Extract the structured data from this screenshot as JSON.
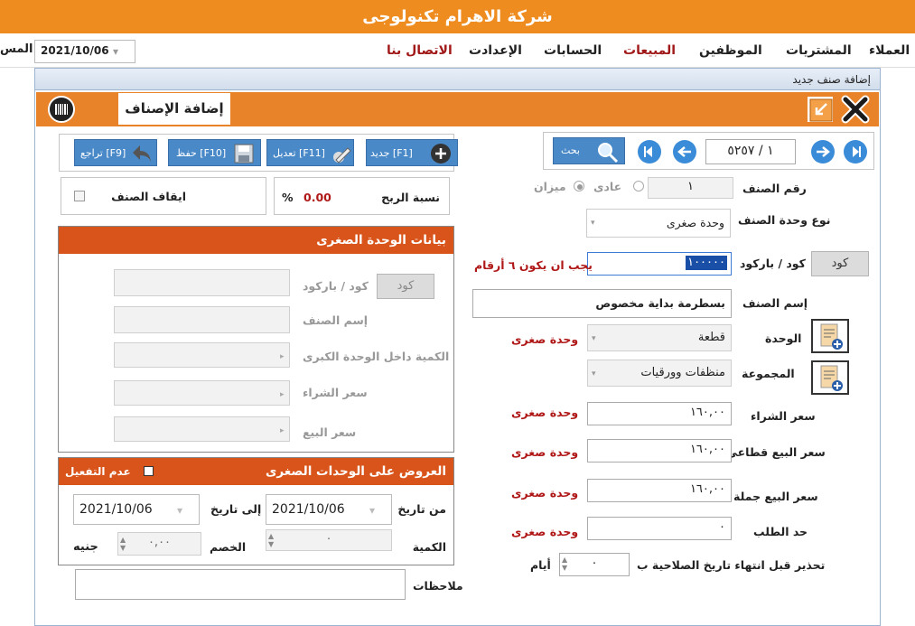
{
  "app": {
    "title": "شركة الاهرام تكنولوجى"
  },
  "menu": {
    "items": [
      "العملاء",
      "المشتريات",
      "الموظفين",
      "المبيعات",
      "الحسابات",
      "الإعدادت",
      "الاتصال بنا"
    ],
    "date": "2021/10/06",
    "cut_label": "المس"
  },
  "window": {
    "title": "إضافة صنف جديد",
    "header_tab": "إضافة الإصناف"
  },
  "nav": {
    "record": "١ / ٥٢٥٧",
    "search_label": "بحث"
  },
  "toolbar": {
    "new_label": "جديد [F1]",
    "edit_label": "تعديل [F11]",
    "save_label": "حفظ [F10]",
    "undo_label": "تراجع [F9]"
  },
  "form": {
    "item_no_label": "رقم الصنف",
    "item_no": "١",
    "type_normal": "عادى",
    "type_scale": "ميزان",
    "unit_type_label": "نوع وحدة الصنف",
    "unit_type": "وحدة صغرى",
    "code_btn": "كود",
    "barcode_label": "كود / باركود",
    "barcode": "١٠٠٠٠٠",
    "barcode_warning": "يجب ان يكون ٦ أرقام",
    "name_label": "إسم الصنف",
    "name": "بسطرمة بداية مخصوص",
    "unit_label": "الوحدة",
    "unit": "قطعة",
    "unit_note": "وحدة صغرى",
    "group_label": "المجموعة",
    "group": "منظفات وورقيات",
    "purchase_label": "سعر الشراء",
    "purchase": "١٦٠,٠٠",
    "purchase_note": "وحدة صغرى",
    "retail_label": "سعر البيع قطاعى",
    "retail": "١٦٠,٠٠",
    "retail_note": "وحدة صغرى",
    "wholesale_label": "سعر البيع جملة",
    "wholesale": "١٦٠,٠٠",
    "wholesale_note": "وحدة صغرى",
    "reorder_label": "حد الطلب",
    "reorder": "٠",
    "reorder_note": "وحدة صغرى",
    "expiry_label": "تحذير قبل انتهاء تاريخ الصلاحية ب",
    "expiry_days": "٠",
    "expiry_unit": "أيام"
  },
  "left": {
    "profit_label": "نسبة الربح",
    "profit_value": "0.00",
    "profit_unit": "%",
    "stop_label": "ايقاف الصنف",
    "small_unit_title": "بيانات الوحدة الصغرى",
    "su_code_btn": "كود",
    "su_barcode_label": "كود / باركود",
    "su_name_label": "إسم الصنف",
    "su_qty_label": "الكمية داخل الوحدة الكبرى",
    "su_purchase_label": "سعر الشراء",
    "su_sale_label": "سعر البيع",
    "offers_title": "العروض على الوحدات الصغرى",
    "offers_disable": "عدم التفعيل",
    "from_label": "من  تاريخ",
    "from_date": "2021/10/06",
    "to_label": "إلى تاريخ",
    "to_date": "2021/10/06",
    "qty_label": "الكمية",
    "qty_value": "٠",
    "discount_label": "الخصم",
    "discount_value": "٠,٠٠",
    "currency": "جنيه",
    "notes_label": "ملاحظات"
  }
}
